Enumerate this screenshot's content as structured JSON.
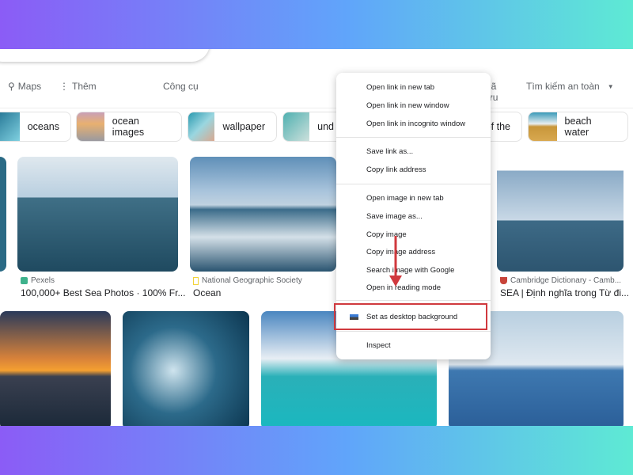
{
  "header": {
    "nav": {
      "maps": "Maps",
      "more": "Thêm",
      "tools": "Công cụ",
      "saved": "Đã lưu",
      "safe_search": "Tìm kiếm an toàn"
    }
  },
  "chips": [
    {
      "label": "oceans"
    },
    {
      "label": "ocean images"
    },
    {
      "label": "wallpaper"
    },
    {
      "label": "und"
    },
    {
      "label": "of the"
    },
    {
      "label": "beach water"
    }
  ],
  "results": [
    {
      "source": "Pexels",
      "title": "100,000+ Best Sea Photos · 100% Fr..."
    },
    {
      "source": "National Geographic Society",
      "title": "Ocean"
    },
    {
      "source": "Cambridge Dictionary - Camb...",
      "title": "SEA | Định nghĩa trong Từ đi..."
    }
  ],
  "context_menu": {
    "items": [
      "Open link in new tab",
      "Open link in new window",
      "Open link in incognito window",
      "Save link as...",
      "Copy link address",
      "Open image in new tab",
      "Save image as...",
      "Copy image",
      "Copy image address",
      "Search image with Google",
      "Open in reading mode",
      "Set as desktop background",
      "Inspect"
    ],
    "highlighted": "Set as desktop background"
  },
  "colors": {
    "highlight": "#d0393e",
    "arrow": "#d0393e"
  }
}
